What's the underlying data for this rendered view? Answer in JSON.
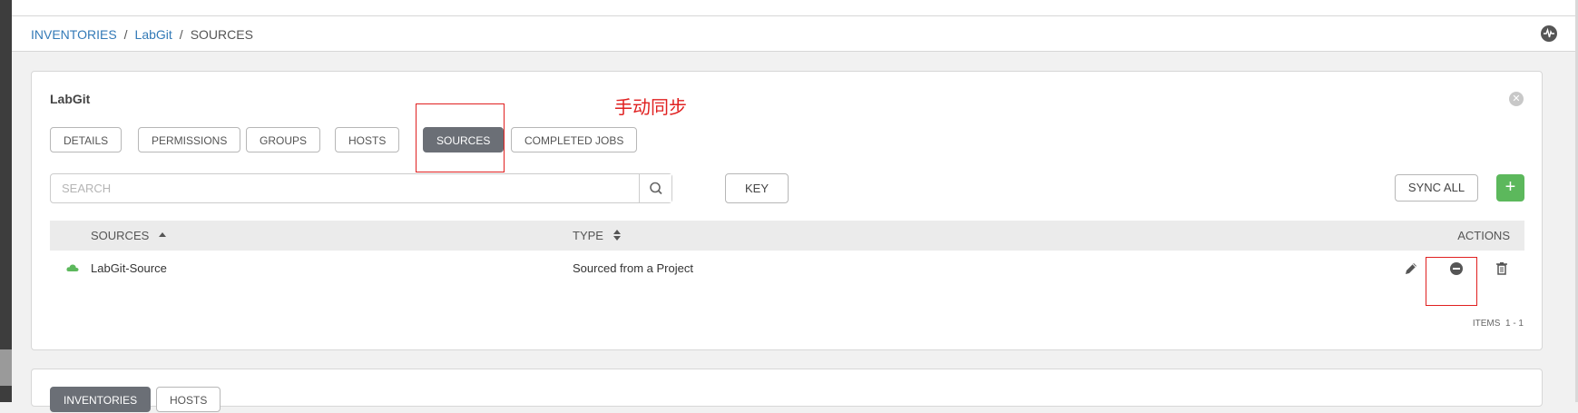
{
  "breadcrumb": {
    "items": [
      "INVENTORIES",
      "LabGit"
    ],
    "separator": "/",
    "current": "SOURCES"
  },
  "panel": {
    "title": "LabGit",
    "tabs": [
      "DETAILS",
      "PERMISSIONS",
      "GROUPS",
      "HOSTS",
      "SOURCES",
      "COMPLETED JOBS"
    ],
    "active_tab": "SOURCES"
  },
  "annotation": {
    "text": "手动同步",
    "color": "#e02020"
  },
  "toolbar": {
    "search_placeholder": "SEARCH",
    "key_label": "KEY",
    "sync_all_label": "SYNC ALL",
    "add_label": "+"
  },
  "table": {
    "columns": [
      "SOURCES",
      "TYPE",
      "ACTIONS"
    ],
    "sort_column": "SOURCES",
    "rows": [
      {
        "name": "LabGit-Source",
        "type": "Sourced from a Project",
        "status_icon": "cloud-icon"
      }
    ],
    "items_label": "ITEMS",
    "items_range": "1 - 1"
  },
  "bottom_panel": {
    "tabs": [
      "INVENTORIES",
      "HOSTS"
    ],
    "active_tab": "INVENTORIES"
  },
  "colors": {
    "accent": "#337ab7",
    "active_tab": "#6b6f76",
    "add_button": "#5cb85c",
    "status_ok": "#5cb85c"
  }
}
